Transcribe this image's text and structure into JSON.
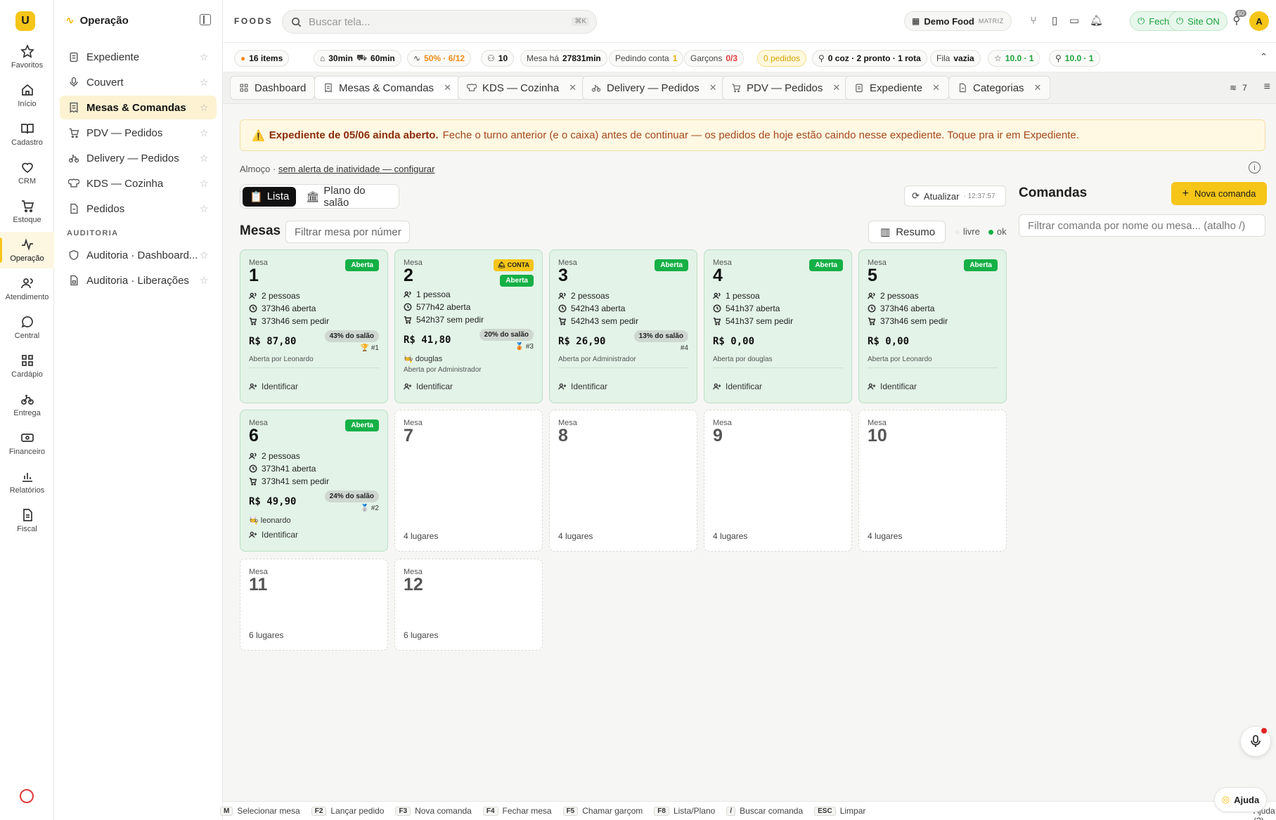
{
  "rail": {
    "logo": "U",
    "items": [
      {
        "label": "Favoritos",
        "icon": "star-icon"
      },
      {
        "label": "Início",
        "icon": "home-icon"
      },
      {
        "label": "Cadastro",
        "icon": "book-icon"
      },
      {
        "label": "CRM",
        "icon": "heart-icon"
      },
      {
        "label": "Estoque",
        "icon": "cart-icon"
      },
      {
        "label": "Operação",
        "icon": "activity-icon"
      },
      {
        "label": "Atendimento",
        "icon": "users-icon"
      },
      {
        "label": "Central",
        "icon": "chat-icon"
      },
      {
        "label": "Cardápio",
        "icon": "grid-icon"
      },
      {
        "label": "Entrega",
        "icon": "bike-icon"
      },
      {
        "label": "Financeiro",
        "icon": "money-icon"
      },
      {
        "label": "Relatórios",
        "icon": "chart-icon"
      },
      {
        "label": "Fiscal",
        "icon": "file-icon"
      }
    ]
  },
  "sidebar": {
    "title": "Operação",
    "items": [
      {
        "label": "Expediente",
        "icon": "clipboard-icon"
      },
      {
        "label": "Couvert",
        "icon": "mic-icon"
      },
      {
        "label": "Mesas & Comandas",
        "icon": "receipt-icon"
      },
      {
        "label": "PDV — Pedidos",
        "icon": "cart-icon"
      },
      {
        "label": "Delivery — Pedidos",
        "icon": "bike-icon"
      },
      {
        "label": "KDS — Cozinha",
        "icon": "chef-icon"
      },
      {
        "label": "Pedidos",
        "icon": "doc-icon"
      }
    ],
    "section": "AUDITORIA",
    "audit_items": [
      {
        "label": "Auditoria · Dashboard...",
        "icon": "shield-icon"
      },
      {
        "label": "Auditoria · Liberações",
        "icon": "doc-lock-icon"
      }
    ]
  },
  "topbar": {
    "brand": "FOODS",
    "search_placeholder": "Buscar tela...",
    "search_kbd": "⌘K",
    "store": "Demo Food",
    "store_tag": "MATRIZ",
    "close_label": "Fechar",
    "site_label": "Site ON",
    "notif_count": "60",
    "avatar": "A"
  },
  "stats": {
    "items": "16 items",
    "prep": "30min",
    "delivery": "60min",
    "occupancy": "50% · 6/12",
    "people": "10",
    "mesa_ha_label": "Mesa há",
    "mesa_ha_val": "27831min",
    "pedindo_label": "Pedindo conta",
    "pedindo_val": "1",
    "garcons_label": "Garçons",
    "garcons_val": "0/3",
    "pedidos": "0 pedidos",
    "routes": "0 coz · 2 pronto · 1 rota",
    "fila_label": "Fila",
    "fila_val": "vazia",
    "rating1": "10.0 · 1",
    "rating2": "10.0 · 1"
  },
  "tabs": [
    {
      "label": "Dashboard",
      "closable": false
    },
    {
      "label": "Mesas & Comandas",
      "closable": true
    },
    {
      "label": "KDS — Cozinha",
      "closable": true
    },
    {
      "label": "Delivery — Pedidos",
      "closable": true
    },
    {
      "label": "PDV — Pedidos",
      "closable": true
    },
    {
      "label": "Expediente",
      "closable": true
    },
    {
      "label": "Categorias",
      "closable": true
    }
  ],
  "tabs_count": "7",
  "alert": {
    "title": "Expediente de 05/06 ainda aberto.",
    "text": "Feche o turno anterior (e o caixa) antes de continuar — os pedidos de hoje estão caindo nesse expediente. Toque pra ir em Expediente."
  },
  "almoco": {
    "label": "Almoço ·",
    "link": "sem alerta de inatividade — configurar"
  },
  "view": {
    "lista": "Lista",
    "plano": "Plano do salão"
  },
  "refresh": {
    "label": "Atualizar",
    "time": "· 12:37:57"
  },
  "mesas": {
    "title": "Mesas",
    "filter_placeholder": "Filtrar mesa por númer",
    "resumo": "Resumo",
    "legend_livre": "livre",
    "legend_ok": "ok",
    "label": "Mesa",
    "status_aberta": "Aberta",
    "status_conta": "CONTA",
    "identify": "Identificar"
  },
  "tables_busy": [
    {
      "num": "1",
      "people": "2 pessoas",
      "open": "373h46 aberta",
      "idle": "373h46 sem pedir",
      "price": "R$ 87,80",
      "pct": "43% do salão",
      "rank": "🏆 #1",
      "waiter": "",
      "opened_by": "Aberta por Leonardo",
      "conta": false
    },
    {
      "num": "2",
      "people": "1 pessoa",
      "open": "577h42 aberta",
      "idle": "542h37 sem pedir",
      "price": "R$ 41,80",
      "pct": "20% do salão",
      "rank": "🥉 #3",
      "waiter": "🧑‍🍳 douglas",
      "opened_by": "Aberta por Administrador",
      "conta": true
    },
    {
      "num": "3",
      "people": "2 pessoas",
      "open": "542h43 aberta",
      "idle": "542h43 sem pedir",
      "price": "R$ 26,90",
      "pct": "13% do salão",
      "rank": "#4",
      "waiter": "",
      "opened_by": "Aberta por Administrador",
      "conta": false
    },
    {
      "num": "4",
      "people": "1 pessoa",
      "open": "541h37 aberta",
      "idle": "541h37 sem pedir",
      "price": "R$ 0,00",
      "pct": "",
      "rank": "",
      "waiter": "",
      "opened_by": "Aberta por douglas",
      "conta": false
    },
    {
      "num": "5",
      "people": "2 pessoas",
      "open": "373h46 aberta",
      "idle": "373h46 sem pedir",
      "price": "R$ 0,00",
      "pct": "",
      "rank": "",
      "waiter": "",
      "opened_by": "Aberta por Leonardo",
      "conta": false
    },
    {
      "num": "6",
      "people": "2 pessoas",
      "open": "373h41 aberta",
      "idle": "373h41 sem pedir",
      "price": "R$ 49,90",
      "pct": "24% do salão",
      "rank": "🥈 #2",
      "waiter": "🧑‍🍳 leonardo",
      "opened_by": "",
      "conta": false
    }
  ],
  "tables_free": [
    {
      "num": "7",
      "seats": "4 lugares"
    },
    {
      "num": "8",
      "seats": "4 lugares"
    },
    {
      "num": "9",
      "seats": "4 lugares"
    },
    {
      "num": "10",
      "seats": "4 lugares"
    },
    {
      "num": "11",
      "seats": "6 lugares"
    },
    {
      "num": "12",
      "seats": "6 lugares"
    }
  ],
  "comandas": {
    "title": "Comandas",
    "new": "Nova comanda",
    "filter_placeholder": "Filtrar comanda por nome ou mesa... (atalho /)"
  },
  "footer": {
    "shortcuts": [
      {
        "k": "M",
        "label": "Selecionar mesa"
      },
      {
        "k": "F2",
        "label": "Lançar pedido"
      },
      {
        "k": "F3",
        "label": "Nova comanda"
      },
      {
        "k": "F4",
        "label": "Fechar mesa"
      },
      {
        "k": "F5",
        "label": "Chamar garçom"
      },
      {
        "k": "F8",
        "label": "Lista/Plano"
      },
      {
        "k": "/",
        "label": "Buscar comanda"
      },
      {
        "k": "ESC",
        "label": "Limpar"
      }
    ],
    "help": "Ajuda (?)"
  },
  "ajuda": "Ajuda",
  "colors": {
    "accent": "#f5c518",
    "green": "#15b046",
    "busy_bg": "#e3f3e7"
  }
}
